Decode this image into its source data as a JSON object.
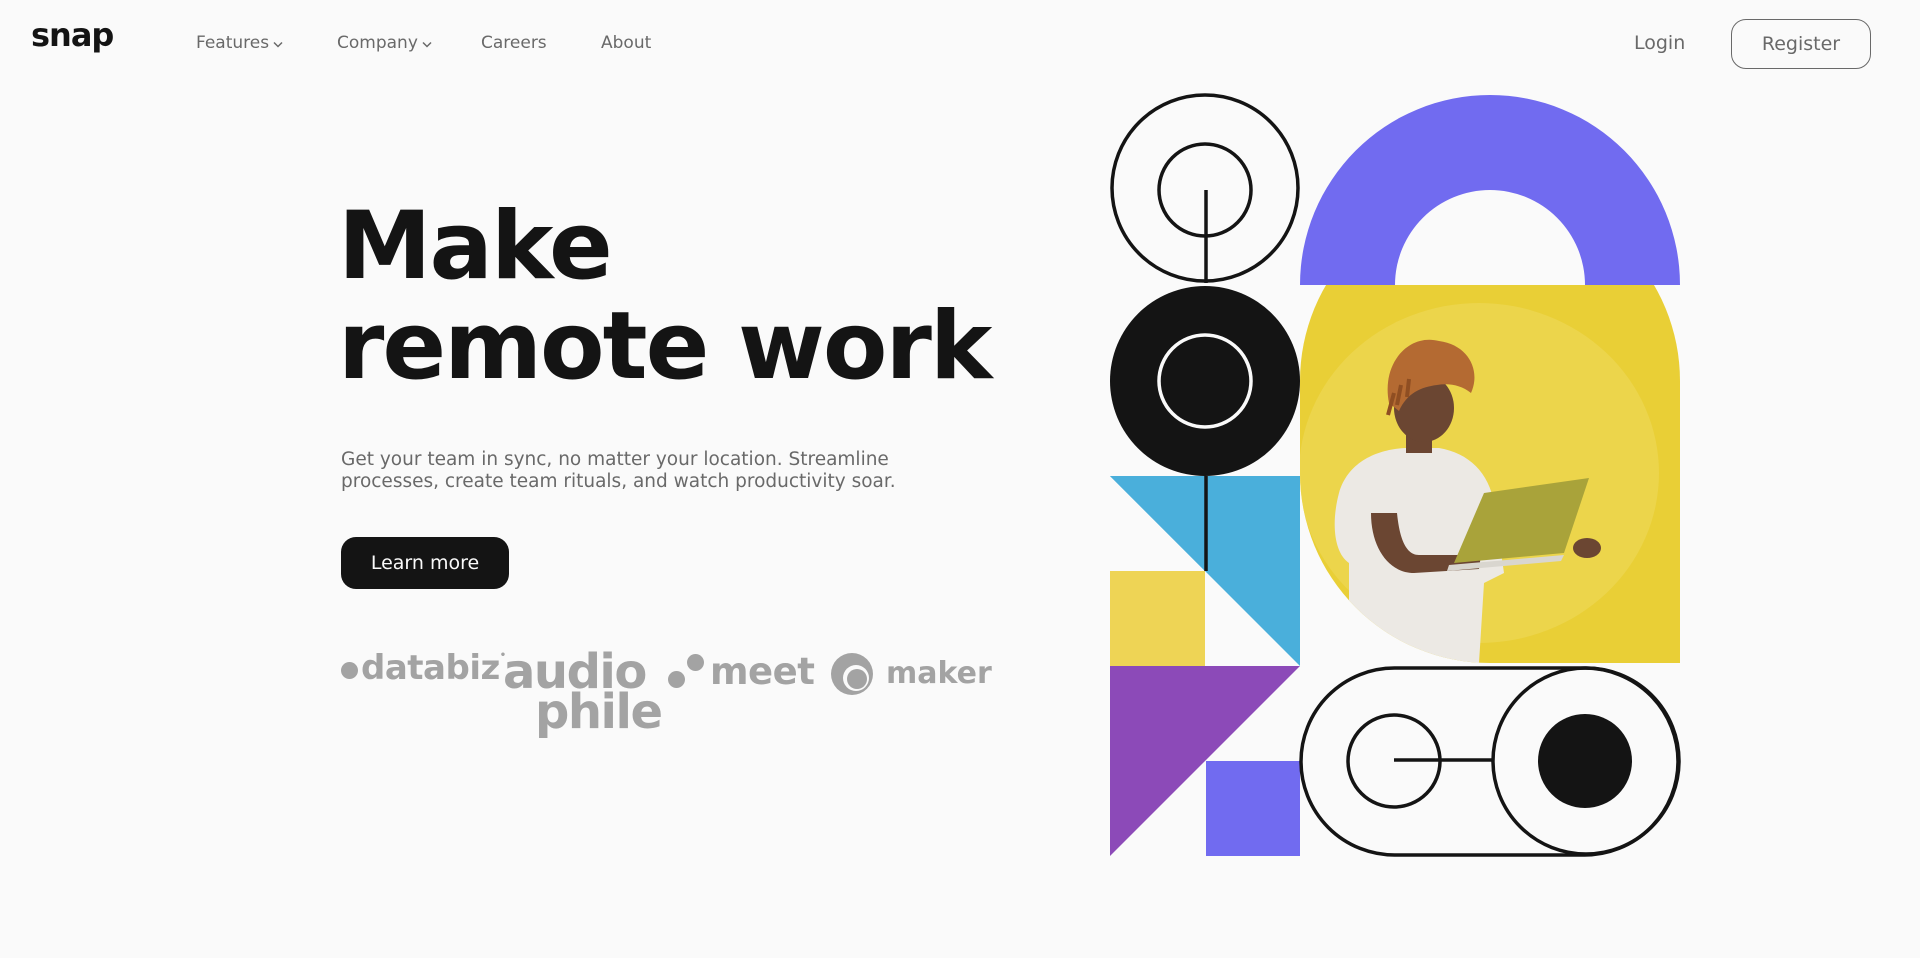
{
  "brand": {
    "logo_text": "snap"
  },
  "nav": {
    "items": [
      {
        "label": "Features",
        "has_dropdown": true
      },
      {
        "label": "Company",
        "has_dropdown": true
      },
      {
        "label": "Careers",
        "has_dropdown": false
      },
      {
        "label": "About",
        "has_dropdown": false
      }
    ],
    "login_label": "Login",
    "register_label": "Register"
  },
  "hero": {
    "headline_line1": "Make",
    "headline_line2": "remote work",
    "subtext": "Get your team in sync, no matter your location. Streamline processes, create team rituals, and watch productivity soar.",
    "cta_label": "Learn more"
  },
  "clients": {
    "databiz": "databiz",
    "audiophile_line1": "audio",
    "audiophile_line2": "phile",
    "meet": "meet",
    "maker": "maker"
  },
  "colors": {
    "text_dark": "#141414",
    "text_gray": "#696969",
    "logo_gray": "#a3a3a3",
    "background": "#fafafa",
    "purple": "#716bf0",
    "violet": "#8c4ab8",
    "blue": "#4aafdb",
    "yellow": "#eed455",
    "photo_bg": "#e8d23e"
  }
}
